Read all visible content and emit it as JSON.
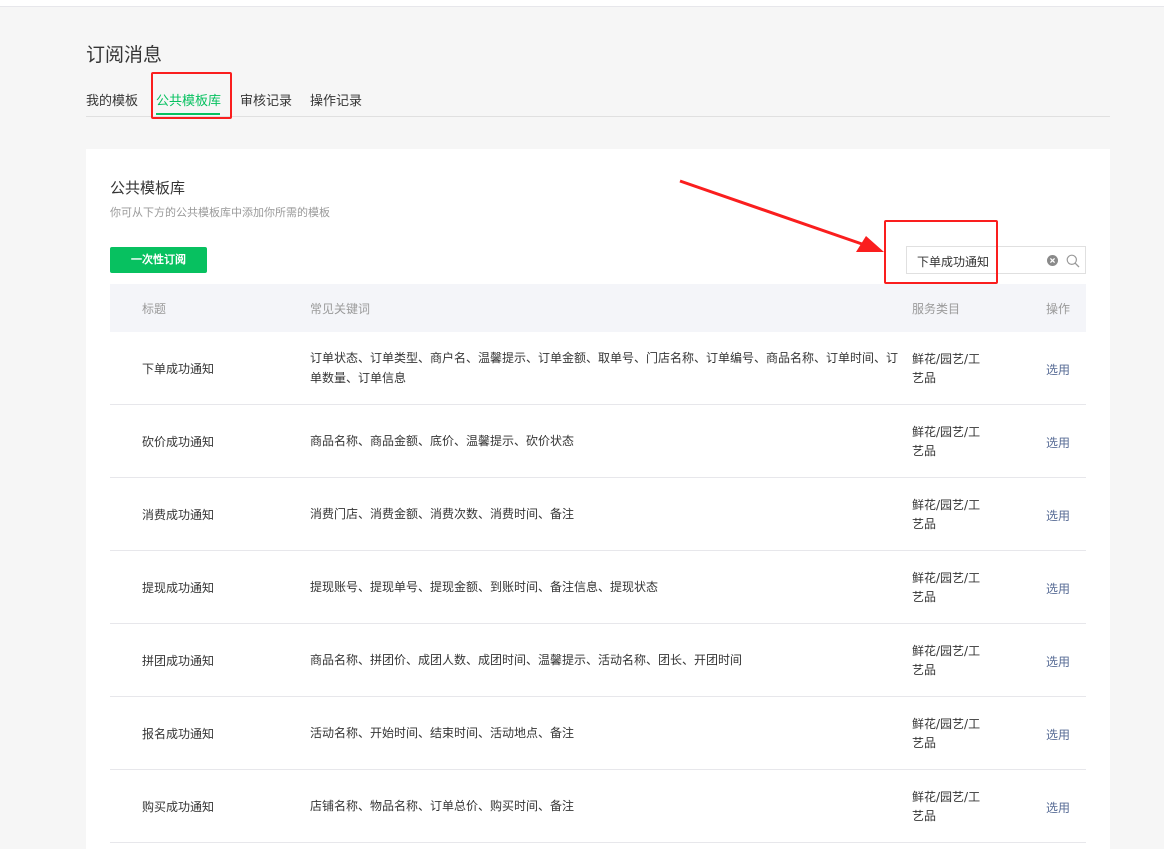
{
  "page": {
    "title": "订阅消息"
  },
  "tabs": [
    {
      "label": "我的模板"
    },
    {
      "label": "公共模板库"
    },
    {
      "label": "审核记录"
    },
    {
      "label": "操作记录"
    }
  ],
  "active_tab": "公共模板库",
  "panel": {
    "title": "公共模板库",
    "description": "你可从下方的公共模板库中添加你所需的模板",
    "primary_button": "一次性订阅"
  },
  "search": {
    "value": "下单成功通知"
  },
  "table": {
    "headers": {
      "title": "标题",
      "keywords": "常见关键词",
      "category": "服务类目",
      "action": "操作"
    },
    "rows": [
      {
        "title": "下单成功通知",
        "keywords": "订单状态、订单类型、商户名、温馨提示、订单金额、取单号、门店名称、订单编号、商品名称、订单时间、订单数量、订单信息",
        "category": "鲜花/园艺/工艺品",
        "action": "选用"
      },
      {
        "title": "砍价成功通知",
        "keywords": "商品名称、商品金额、底价、温馨提示、砍价状态",
        "category": "鲜花/园艺/工艺品",
        "action": "选用"
      },
      {
        "title": "消费成功通知",
        "keywords": "消费门店、消费金额、消费次数、消费时间、备注",
        "category": "鲜花/园艺/工艺品",
        "action": "选用"
      },
      {
        "title": "提现成功通知",
        "keywords": "提现账号、提现单号、提现金额、到账时间、备注信息、提现状态",
        "category": "鲜花/园艺/工艺品",
        "action": "选用"
      },
      {
        "title": "拼团成功通知",
        "keywords": "商品名称、拼团价、成团人数、成团时间、温馨提示、活动名称、团长、开团时间",
        "category": "鲜花/园艺/工艺品",
        "action": "选用"
      },
      {
        "title": "报名成功通知",
        "keywords": "活动名称、开始时间、结束时间、活动地点、备注",
        "category": "鲜花/园艺/工艺品",
        "action": "选用"
      },
      {
        "title": "购买成功通知",
        "keywords": "店铺名称、物品名称、订单总价、购买时间、备注",
        "category": "鲜花/园艺/工艺品",
        "action": "选用"
      }
    ]
  },
  "colors": {
    "accent": "#07c160",
    "link": "#576b95",
    "annotation": "#fa1e1e"
  }
}
